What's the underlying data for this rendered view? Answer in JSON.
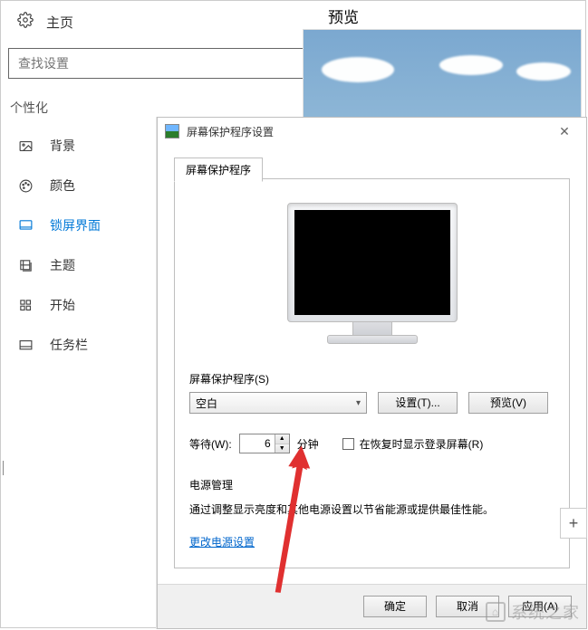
{
  "sidebar": {
    "home": "主页",
    "search_placeholder": "查找设置",
    "category": "个性化",
    "items": [
      {
        "label": "背景"
      },
      {
        "label": "颜色"
      },
      {
        "label": "锁屏界面"
      },
      {
        "label": "主题"
      },
      {
        "label": "开始"
      },
      {
        "label": "任务栏"
      }
    ]
  },
  "preview": {
    "title": "预览"
  },
  "dialog": {
    "title": "屏幕保护程序设置",
    "tab": "屏幕保护程序",
    "ss_label": "屏幕保护程序(S)",
    "ss_value": "空白",
    "settings_btn": "设置(T)...",
    "preview_btn": "预览(V)",
    "wait_label": "等待(W):",
    "wait_value": "6",
    "wait_unit": "分钟",
    "resume_label": "在恢复时显示登录屏幕(R)",
    "power_title": "电源管理",
    "power_desc": "通过调整显示亮度和其他电源设置以节省能源或提供最佳性能。",
    "power_link": "更改电源设置",
    "ok": "确定",
    "cancel": "取消",
    "apply": "应用(A)"
  },
  "watermark": "系统之家"
}
